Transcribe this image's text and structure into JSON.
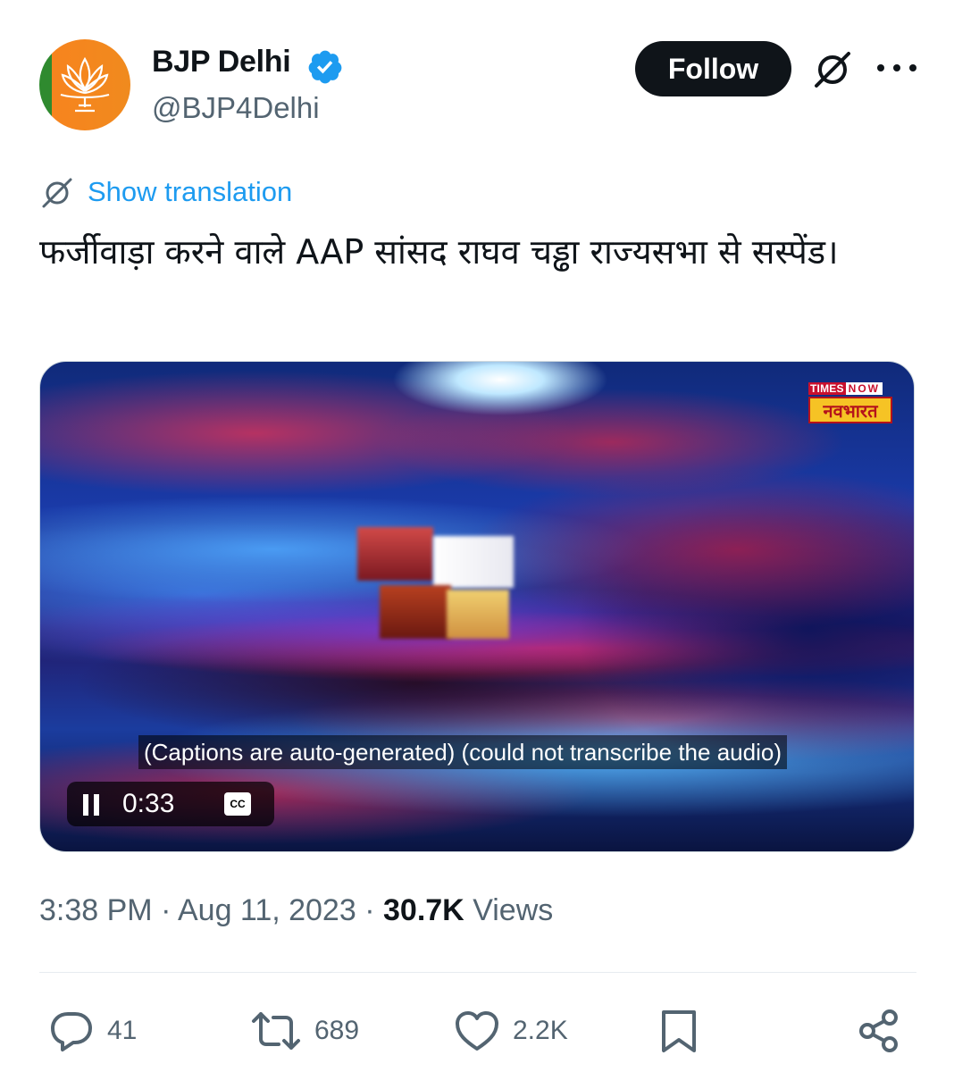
{
  "account": {
    "display_name": "BJP Delhi",
    "handle": "@BJP4Delhi",
    "verified": true,
    "avatar_icon": "bjp-lotus-logo"
  },
  "header_actions": {
    "follow_label": "Follow",
    "grok_icon": "grok-icon",
    "more_icon": "more-icon"
  },
  "translation": {
    "label": "Show translation",
    "icon": "translate-icon"
  },
  "tweet": {
    "text": "फर्जीवाड़ा करने वाले AAP सांसद राघव चड्ढा राज्यसभा से सस्पेंड।"
  },
  "video": {
    "channel_logo": {
      "top_left": "TIMES",
      "top_right": "NOW",
      "bottom": "नवभारत"
    },
    "captions": "(Captions are auto-generated) (could not transcribe the audio)",
    "time": "0:33",
    "cc_label": "CC",
    "state": "playing"
  },
  "meta": {
    "time": "3:38 PM",
    "separator": "·",
    "date": "Aug 11, 2023",
    "views_count": "30.7K",
    "views_label": "Views"
  },
  "actions": {
    "replies": "41",
    "reposts": "689",
    "likes": "2.2K"
  },
  "colors": {
    "accent": "#1d9bf0",
    "text_primary": "#0f1419",
    "text_secondary": "#536471",
    "follow_bg": "#0f1419"
  }
}
